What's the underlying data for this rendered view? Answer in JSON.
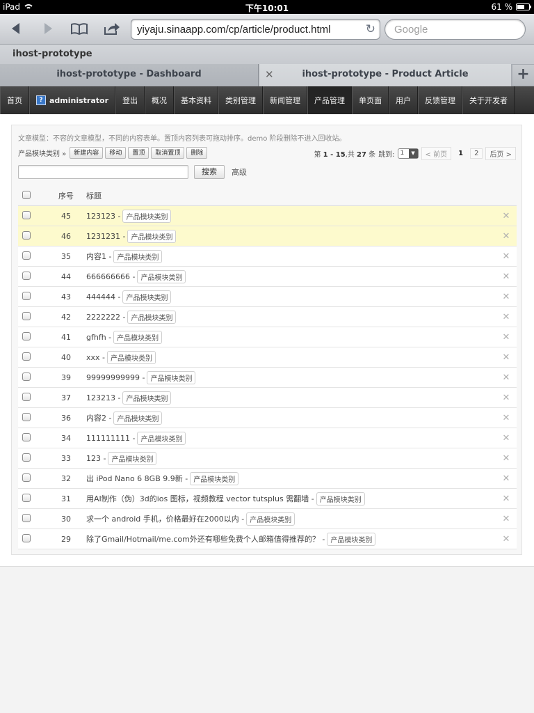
{
  "statusbar": {
    "device": "iPad",
    "time": "下午10:01",
    "battery": "61 %",
    "battery_level": 0.61
  },
  "browser": {
    "url": "yiyaju.sinaapp.com/cp/article/product.html",
    "search_placeholder": "Google",
    "bookmark_title": "ihost-prototype",
    "tabs": [
      {
        "label": "ihost-prototype - Dashboard"
      },
      {
        "label": "ihost-prototype - Product Article"
      }
    ],
    "icons": {
      "back": "back-arrow-icon",
      "forward": "forward-arrow-icon",
      "bookmarks": "book-icon",
      "share": "share-icon",
      "reload": "reload-icon",
      "close_tab": "close-icon",
      "add_tab": "plus-icon"
    }
  },
  "nav": {
    "items": [
      {
        "label": "首页"
      },
      {
        "label": "administrator",
        "avatar": "?"
      },
      {
        "label": "登出"
      },
      {
        "label": "概况"
      },
      {
        "label": "基本资料"
      },
      {
        "label": "类别管理"
      },
      {
        "label": "新闻管理"
      },
      {
        "label": "产品管理",
        "active": true
      },
      {
        "label": "单页面"
      },
      {
        "label": "用户"
      },
      {
        "label": "反馈管理"
      },
      {
        "label": "关于开发者"
      }
    ]
  },
  "content": {
    "note": "文章模型：不容的文章模型，不同的内容表单。置顶内容列表可拖动排序。demo 阶段删除不进入回收站。",
    "breadcrumb": "产品模块类别 »",
    "actions": {
      "new": "新建内容",
      "move": "移动",
      "pin": "置顶",
      "unpin": "取消置顶",
      "delete": "删除"
    },
    "pager": {
      "summary_prefix": "第",
      "range": "1 - 15",
      "summary_mid": ",共",
      "total": "27",
      "summary_suffix": "条",
      "jump_label": "跳到:",
      "jump_value": "1",
      "prev": "< 前页",
      "current": "1",
      "next_page": "2",
      "next": "后页 >"
    },
    "search": {
      "button": "搜索",
      "advanced": "高级"
    },
    "table": {
      "headers": {
        "no": "序号",
        "title": "标题"
      },
      "tag": "产品模块类别",
      "rows": [
        {
          "no": "45",
          "title": "123123 -",
          "pinned": true
        },
        {
          "no": "46",
          "title": "1231231 -",
          "pinned": true
        },
        {
          "no": "35",
          "title": "内容1 -"
        },
        {
          "no": "44",
          "title": "666666666 -"
        },
        {
          "no": "43",
          "title": "444444 -"
        },
        {
          "no": "42",
          "title": "2222222 -"
        },
        {
          "no": "41",
          "title": "gfhfh -"
        },
        {
          "no": "40",
          "title": "xxx -"
        },
        {
          "no": "39",
          "title": "99999999999 -"
        },
        {
          "no": "37",
          "title": "123213 -"
        },
        {
          "no": "36",
          "title": "内容2 -"
        },
        {
          "no": "34",
          "title": "111111111 -"
        },
        {
          "no": "33",
          "title": "123 -"
        },
        {
          "no": "32",
          "title": "出 iPod Nano 6 8GB 9.9新 -"
        },
        {
          "no": "31",
          "title": "用AI制作（伪）3d的ios 图标，视频教程 vector tutsplus 需翻墙 -"
        },
        {
          "no": "30",
          "title": "求一个 android 手机，价格最好在2000以内 -"
        },
        {
          "no": "29",
          "title": "除了Gmail/Hotmail/me.com外还有哪些免费个人邮箱值得推荐的？ -"
        }
      ]
    }
  }
}
